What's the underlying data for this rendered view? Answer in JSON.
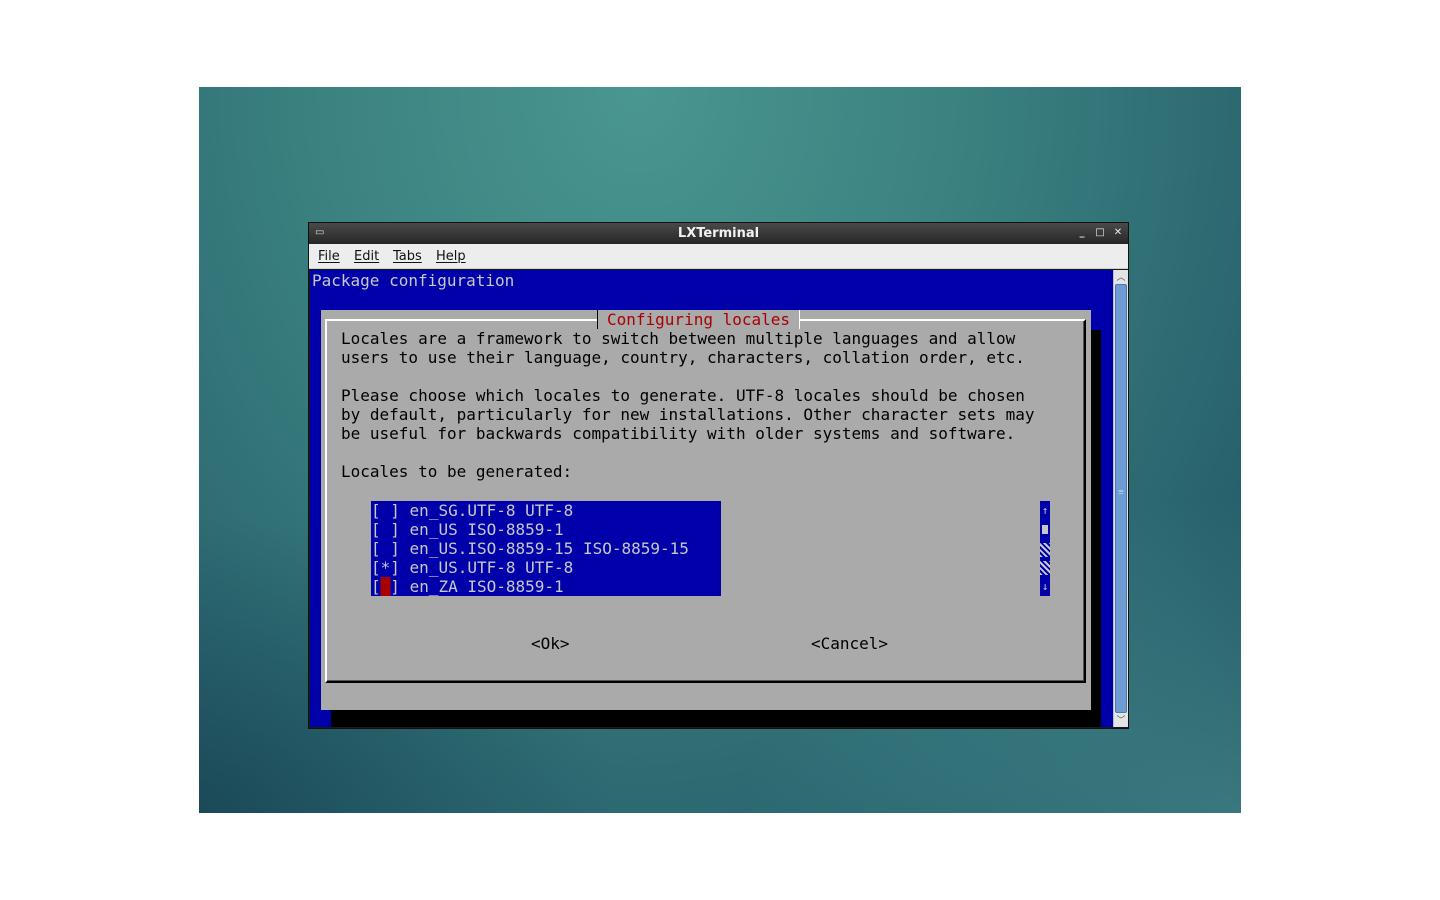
{
  "window": {
    "title": "LXTerminal",
    "controls": {
      "minimize": "_",
      "maximize": "□",
      "close": "✕"
    }
  },
  "menu": [
    "File",
    "Edit",
    "Tabs",
    "Help"
  ],
  "terminal": {
    "header": "Package configuration",
    "dialog": {
      "title": "Configuring locales",
      "description": [
        "Locales are a framework to switch between multiple languages and allow",
        "users to use their language, country, characters, collation order, etc.",
        "",
        "Please choose which locales to generate. UTF-8 locales should be chosen",
        "by default, particularly for new installations. Other character sets may",
        "be useful for backwards compatibility with older systems and software."
      ],
      "prompt": "Locales to be generated:",
      "locales": [
        {
          "mark": "[ ]",
          "label": "en_SG.UTF-8 UTF-8",
          "checked": false
        },
        {
          "mark": "[ ]",
          "label": "en_US ISO-8859-1",
          "checked": false
        },
        {
          "mark": "[ ]",
          "label": "en_US.ISO-8859-15 ISO-8859-15",
          "checked": false
        },
        {
          "mark": "[*]",
          "label": "en_US.UTF-8 UTF-8",
          "checked": true
        },
        {
          "mark": "[ ]",
          "label": "en_ZA ISO-8859-1",
          "checked": false,
          "cursor": true
        }
      ],
      "list_scroll": {
        "up": "↑",
        "down": "↓"
      },
      "ok_label": "<Ok>",
      "cancel_label": "<Cancel>"
    }
  },
  "colors": {
    "terminal_bg": "#0000aa",
    "dialog_bg": "#aaaaaa",
    "dialog_title": "#aa0000",
    "cursor": "#aa0000",
    "scroll_thumb": "#6d9bd3"
  },
  "icons": {
    "window": "terminal-icon",
    "scroll_up": "arrow-up-icon",
    "scroll_down": "arrow-down-icon"
  }
}
